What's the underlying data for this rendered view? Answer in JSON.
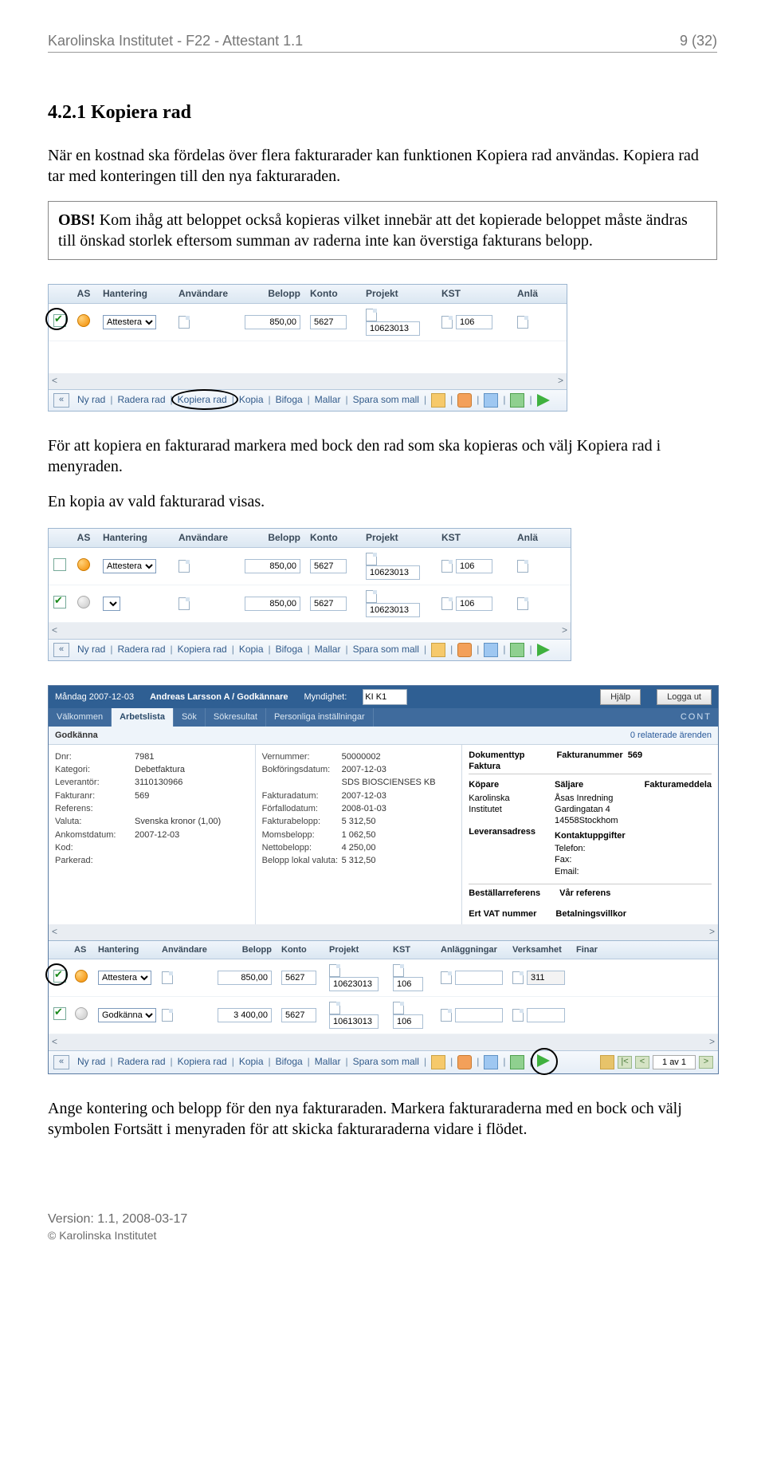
{
  "header": {
    "left": "Karolinska Institutet - F22 - Attestant 1.1",
    "right": "9 (32)"
  },
  "section_title": "4.2.1  Kopiera rad",
  "para1": "När en kostnad ska fördelas över flera fakturarader kan funktionen Kopiera rad användas. Kopiera rad tar med konteringen till den nya fakturaraden.",
  "obs_label": "OBS!",
  "obs_text": "Kom ihåg att beloppet också kopieras vilket innebär att det kopierade beloppet måste ändras till önskad storlek eftersom summan av raderna inte kan överstiga fakturans belopp.",
  "grid_headers": {
    "as": "AS",
    "hantering": "Hantering",
    "anvandare": "Användare",
    "belopp": "Belopp",
    "konto": "Konto",
    "projekt": "Projekt",
    "kst": "KST",
    "anla": "Anlä"
  },
  "shot1_rows": [
    {
      "checked": true,
      "status": "orange",
      "hantering": "Attestera",
      "belopp": "850,00",
      "konto": "5627",
      "projekt": "10623013",
      "kst": "106"
    }
  ],
  "toolbar": {
    "nyrad": "Ny rad",
    "radera": "Radera rad",
    "kopiera": "Kopiera rad",
    "kopia": "Kopia",
    "bifoga": "Bifoga",
    "mallar": "Mallar",
    "spara": "Spara som mall"
  },
  "para2": "För att kopiera en fakturarad markera med bock den rad som ska kopieras och välj Kopiera rad i menyraden.",
  "para3": "En kopia av vald fakturarad visas.",
  "shot2_rows": [
    {
      "checked": false,
      "status": "orange",
      "hantering": "Attestera",
      "belopp": "850,00",
      "konto": "5627",
      "projekt": "10623013",
      "kst": "106"
    },
    {
      "checked": true,
      "status": "grey",
      "hantering": "",
      "belopp": "850,00",
      "konto": "5627",
      "projekt": "10623013",
      "kst": "106"
    }
  ],
  "big": {
    "date": "Måndag 2007-12-03",
    "user": "Andreas Larsson A / Godkännare",
    "mynd_label": "Myndighet:",
    "mynd_value": "KI K1",
    "help": "Hjälp",
    "logout": "Logga ut",
    "brand": "CONT",
    "tabs": [
      "Välkommen",
      "Arbetslista",
      "Sök",
      "Sökresultat",
      "Personliga inställningar"
    ],
    "active_tab": "Arbetslista",
    "godkanna": "Godkänna",
    "relaterade": "0 relaterade ärenden",
    "left_kv": [
      [
        "Dnr:",
        "7981"
      ],
      [
        "Kategori:",
        "Debetfaktura"
      ],
      [
        "Leverantör:",
        "3110130966"
      ],
      [
        "Fakturanr:",
        "569"
      ],
      [
        "Referens:",
        ""
      ],
      [
        "Valuta:",
        "Svenska kronor (1,00)"
      ],
      [
        "Ankomstdatum:",
        "2007-12-03"
      ],
      [
        "Kod:",
        ""
      ],
      [
        "Parkerad:",
        ""
      ]
    ],
    "right_kv": [
      [
        "Vernummer:",
        "50000002"
      ],
      [
        "Bokföringsdatum:",
        "2007-12-03"
      ],
      [
        "",
        "SDS BIOSCIENSES KB"
      ],
      [
        "Fakturadatum:",
        "2007-12-03"
      ],
      [
        "Förfallodatum:",
        "2008-01-03"
      ],
      [
        "Fakturabelopp:",
        "5 312,50"
      ],
      [
        "Momsbelopp:",
        "1 062,50"
      ],
      [
        "Nettobelopp:",
        "4 250,00"
      ],
      [
        "Belopp lokal valuta:",
        "5 312,50"
      ]
    ],
    "doc": {
      "doktyp_l": "Dokumenttyp",
      "doktyp_v": "Faktura",
      "fnr_l": "Fakturanummer",
      "fnr_v": "569",
      "kopare_h": "Köpare",
      "kopare": "Karolinska Institutet",
      "saljare_h": "Säljare",
      "saljare": [
        "Åsas Inredning",
        "Gardingatan 4",
        "14558Stockhom"
      ],
      "fmed": "Fakturameddela",
      "lev_l": "Leveransadress",
      "kontakt_h": "Kontaktuppgifter",
      "kontakt": [
        "Telefon:",
        "Fax:",
        "Email:"
      ],
      "b1": "Beställarreferens",
      "b2": "Ert VAT nummer",
      "b3": "Vår referens",
      "b4": "Betalningsvillkor"
    },
    "grid_headers2": {
      "as": "AS",
      "h": "Hantering",
      "u": "Användare",
      "b": "Belopp",
      "k": "Konto",
      "p": "Projekt",
      "ks": "KST",
      "a": "Anläggningar",
      "v": "Verksamhet",
      "f": "Finar"
    },
    "grid_rows": [
      {
        "checked": true,
        "status": "orange",
        "h": "Attestera",
        "b": "850,00",
        "k": "5627",
        "p": "10623013",
        "ks": "106",
        "a": "",
        "v": "311"
      },
      {
        "checked": true,
        "status": "grey",
        "h": "Godkänna",
        "b": "3 400,00",
        "k": "5627",
        "p": "10613013",
        "ks": "106",
        "a": "",
        "v": ""
      }
    ],
    "pager": "1 av 1"
  },
  "para4": "Ange kontering och belopp för den nya fakturaraden. Markera fakturaraderna med en bock och välj symbolen Fortsätt i menyraden för att skicka fakturaraderna vidare i flödet.",
  "footer": {
    "version": "Version: 1.1, 2008-03-17",
    "copyright": "© Karolinska Institutet"
  }
}
